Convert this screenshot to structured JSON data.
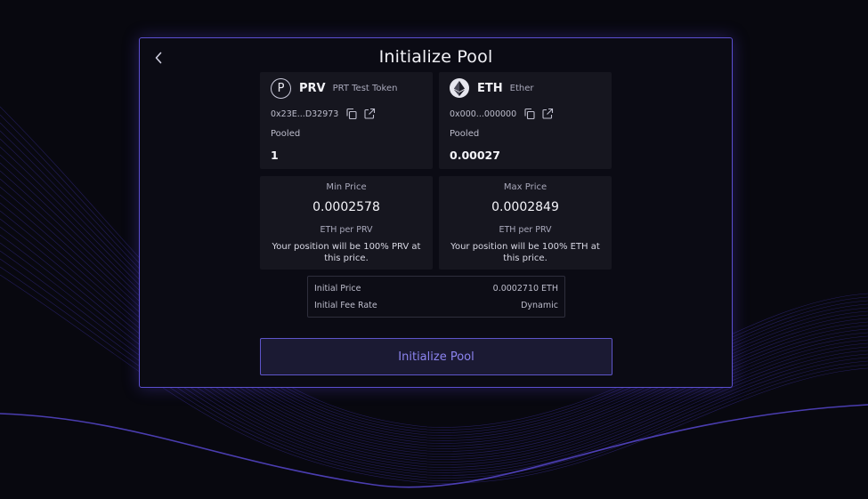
{
  "modal": {
    "title": "Initialize Pool",
    "back_icon": "chevron-left-icon"
  },
  "tokens": [
    {
      "symbol": "PRV",
      "name": "PRT Test Token",
      "icon_letter": "P",
      "address": "0x23E...D32973",
      "pooled_label": "Pooled",
      "pooled_value": "1"
    },
    {
      "symbol": "ETH",
      "name": "Ether",
      "icon": "ethereum-icon",
      "address": "0x000...000000",
      "pooled_label": "Pooled",
      "pooled_value": "0.00027"
    }
  ],
  "prices": {
    "min": {
      "label": "Min Price",
      "value": "0.0002578",
      "unit": "ETH per PRV",
      "note": "Your position will be 100% PRV at this price."
    },
    "max": {
      "label": "Max Price",
      "value": "0.0002849",
      "unit": "ETH per PRV",
      "note": "Your position will be 100% ETH at this price."
    }
  },
  "info": {
    "initial_price_label": "Initial Price",
    "initial_price_value": "0.0002710 ETH",
    "fee_rate_label": "Initial Fee Rate",
    "fee_rate_value": "Dynamic"
  },
  "action": {
    "button_label": "Initialize Pool"
  },
  "colors": {
    "background": "#08080f",
    "accent": "#5b4fd0",
    "card": "#16161f",
    "button_text": "#8c84f0"
  }
}
